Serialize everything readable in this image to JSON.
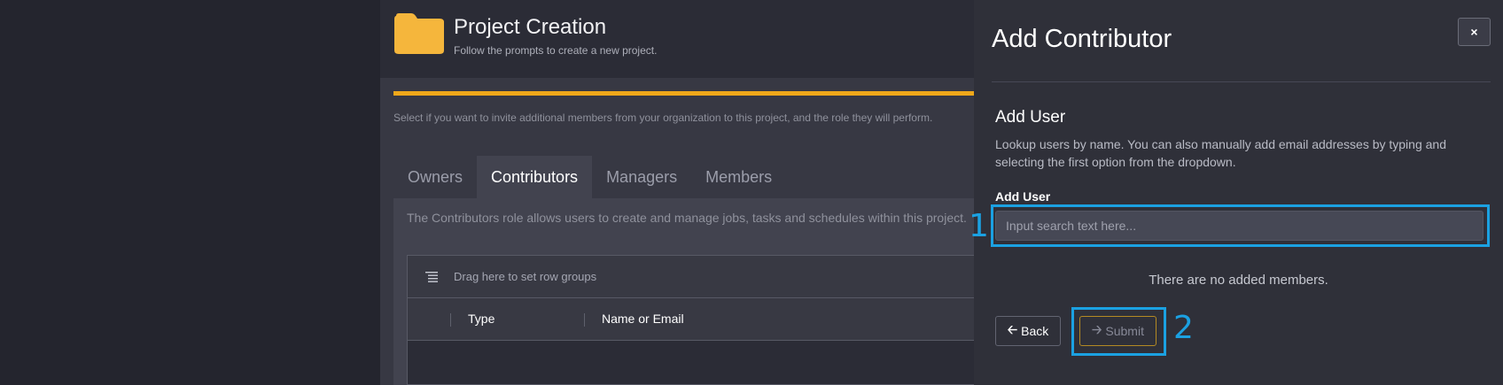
{
  "header": {
    "title": "Project Creation",
    "subtitle": "Follow the prompts to create a new project.",
    "folder_color": "#f5b63c"
  },
  "panel": {
    "progress_percent": 100,
    "hint": "Select if you want to invite additional members from your organization to this project, and the role they will perform.",
    "tabs": [
      {
        "label": "Owners",
        "active": false
      },
      {
        "label": "Contributors",
        "active": true
      },
      {
        "label": "Managers",
        "active": false
      },
      {
        "label": "Members",
        "active": false
      }
    ],
    "role_description": "The Contributors role allows users to create and manage jobs, tasks and schedules within this project.",
    "grid": {
      "groups_placeholder": "Drag here to set row groups",
      "columns": [
        "Type",
        "Name or Email"
      ]
    }
  },
  "drawer": {
    "title": "Add Contributor",
    "close_label": "×",
    "section_title": "Add User",
    "section_description": "Lookup users by name. You can also manually add email addresses by typing and selecting the first option from the dropdown.",
    "field_label": "Add User",
    "search_placeholder": "Input search text here...",
    "empty_message": "There are no added members.",
    "back_label": "Back",
    "submit_label": "Submit"
  },
  "annotations": [
    "1",
    "2"
  ],
  "colors": {
    "accent": "#f0a81a",
    "highlight": "#1ba1e2"
  }
}
